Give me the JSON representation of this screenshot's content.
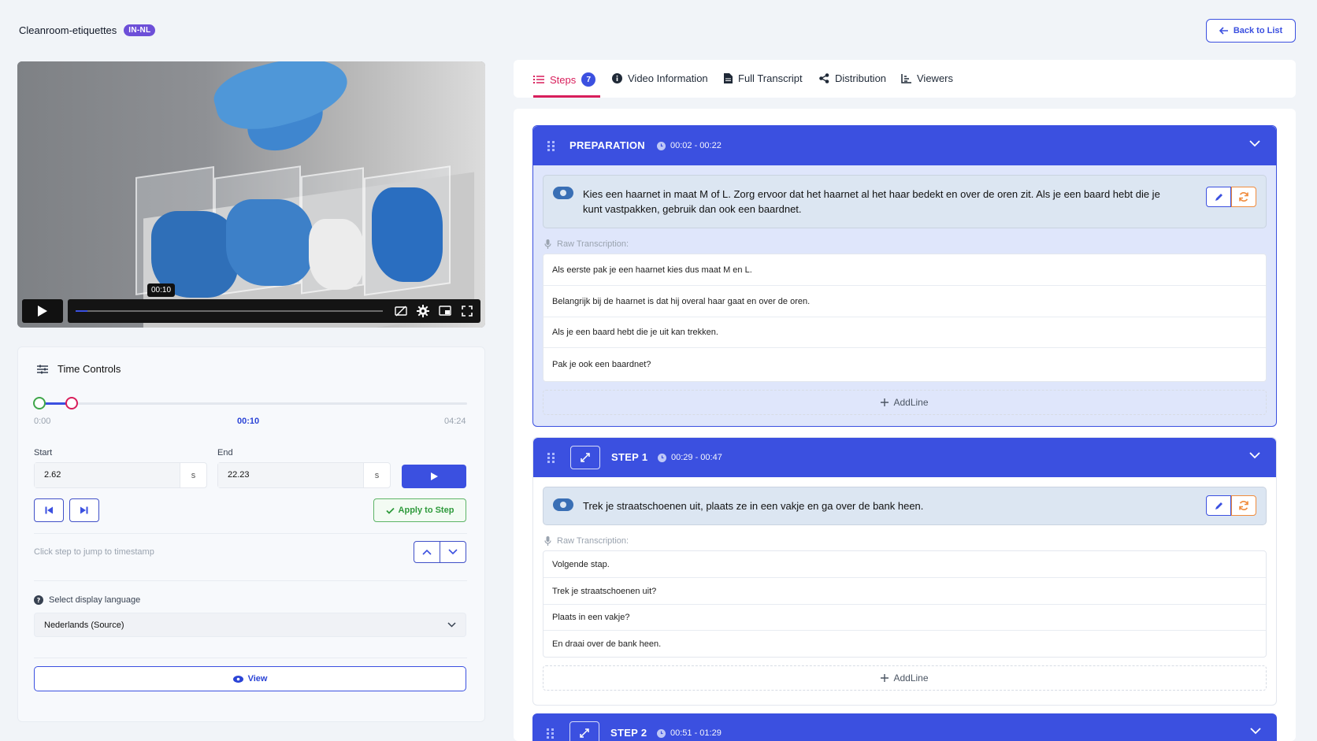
{
  "header": {
    "title": "Cleanroom-etiquettes",
    "badge": "IN-NL",
    "back_label": "Back to List"
  },
  "video": {
    "time_tooltip": "00:10",
    "progress_fraction": 0.039
  },
  "time_controls": {
    "title": "Time Controls",
    "range_min": "0:00",
    "range_current": "00:10",
    "range_max": "04:24",
    "start_label": "Start",
    "start_value": "2.62",
    "start_unit": "s",
    "end_label": "End",
    "end_value": "22.23",
    "end_unit": "s",
    "apply_label": "Apply to Step",
    "hint": "Click step to jump to timestamp",
    "language_label": "Select display language",
    "language_value": "Nederlands (Source)",
    "view_label": "View"
  },
  "tabs": [
    {
      "label": "Steps",
      "count": "7"
    },
    {
      "label": "Video Information"
    },
    {
      "label": "Full Transcript"
    },
    {
      "label": "Distribution"
    },
    {
      "label": "Viewers"
    }
  ],
  "steps": [
    {
      "title": "PREPARATION",
      "time": "00:02 - 00:22",
      "summary": "Kies een haarnet in maat M of L. Zorg ervoor dat het haarnet al het haar bedekt en over de oren zit. Als je een baard hebt die je kunt vastpakken, gebruik dan ook een baardnet.",
      "raw_label": "Raw Transcription:",
      "lines": [
        "Als eerste pak je een haarnet kies dus maat M en L.",
        "Belangrijk bij de haarnet is dat hij overal haar gaat en over de oren.",
        "Als je een baard hebt die je uit kan trekken.",
        "Pak je ook een baardnet?"
      ],
      "add_label": "AddLine"
    },
    {
      "title": "STEP 1",
      "time": "00:29 - 00:47",
      "summary": "Trek je straatschoenen uit, plaats ze in een vakje en ga over de bank heen.",
      "raw_label": "Raw Transcription:",
      "lines": [
        "Volgende stap.",
        "Trek je straatschoenen uit?",
        "Plaats in een vakje?",
        "En draai over de bank heen."
      ],
      "add_label": "AddLine"
    },
    {
      "title": "STEP 2",
      "time": "00:51 - 01:29"
    }
  ],
  "colors": {
    "primary": "#3b50e0",
    "accent": "#d81e5b",
    "success": "#3fa64a",
    "warning": "#f08b3c",
    "badge": "#6d4fd8"
  }
}
